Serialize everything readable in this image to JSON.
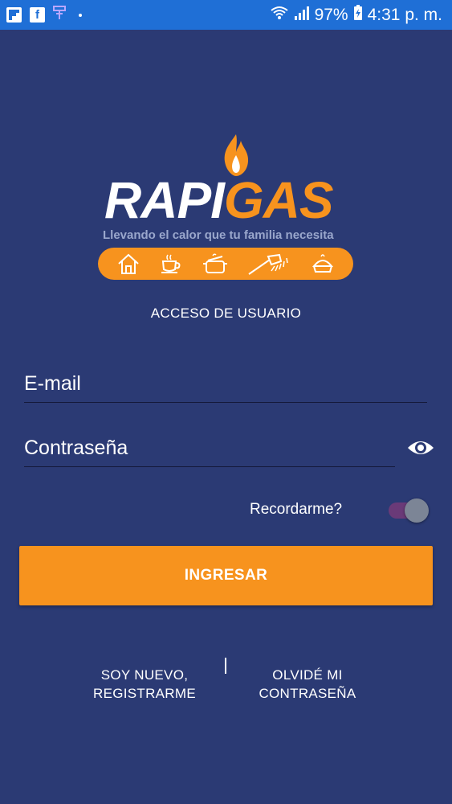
{
  "status_bar": {
    "battery": "97%",
    "time": "4:31 p. m."
  },
  "logo": {
    "brand_part1": "RAPI",
    "brand_part2": "GAS",
    "tagline": "Llevando el calor que tu familia necesita",
    "brand_color_primary": "#ffffff",
    "brand_color_accent": "#f7931e",
    "icons": [
      "house-icon",
      "coffee-cup-icon",
      "cooking-pot-icon",
      "shower-icon",
      "pie-icon"
    ]
  },
  "login": {
    "title": "ACCESO DE USUARIO",
    "email_placeholder": "E-mail",
    "password_placeholder": "Contraseña",
    "remember_label": "Recordarme?",
    "remember_enabled": true,
    "submit_label": "INGRESAR"
  },
  "links": {
    "register_line1": "SOY NUEVO,",
    "register_line2": "REGISTRARME",
    "forgot_line1": "OLVIDÉ MI",
    "forgot_line2": "CONTRASEÑA"
  },
  "colors": {
    "background": "#2b3a74",
    "status_bar": "#1f6fd6",
    "accent": "#f7931e"
  }
}
